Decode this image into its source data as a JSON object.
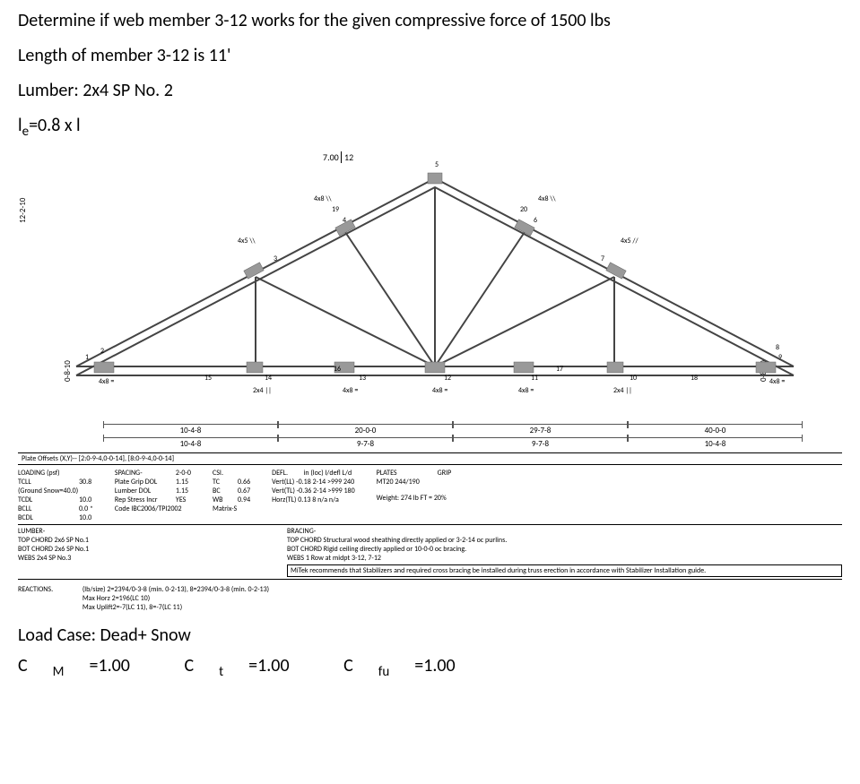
{
  "problem": {
    "line1": "Determine if web member 3-12 works for the given compressive force of 1500 lbs",
    "line2": "Length of member 3-12 is 11'",
    "line3": "Lumber: 2x4 SP No. 2",
    "line4_prefix": "l",
    "line4_sub": "e",
    "line4_suffix": "=0.8 x l"
  },
  "pitch": {
    "rise": "7.00",
    "run": "12"
  },
  "vlabels": {
    "left_outer": "12-2-10",
    "left_inner": "0-8-10",
    "right_inner": "0-8-10"
  },
  "truss": {
    "plates": {
      "p1": "4x8 =",
      "p2": "4x5 \\\\",
      "p3": "4x8 \\\\",
      "p4": "4x8 \\\\",
      "p5": "4x5 //",
      "p6": "4x8 =",
      "b14": "2x4 ||",
      "b13": "4x8 =",
      "b12": "4x8 =",
      "b11": "4x8 =",
      "b10": "2x4 ||"
    },
    "nodes": {
      "n1": "1",
      "n2": "2",
      "n3": "3",
      "n4": "4",
      "n5": "5",
      "n6": "6",
      "n7": "7",
      "n8": "8",
      "n9": "9",
      "n10": "10",
      "n11": "11",
      "n12": "12",
      "n13": "13",
      "n14": "14",
      "n15": "15",
      "n16": "16",
      "n17": "17",
      "n18": "18",
      "n19": "19",
      "n20": "20"
    }
  },
  "dims": {
    "top": [
      "10-4-8",
      "20-0-0",
      "29-7-8",
      "40-0-0"
    ],
    "bot": [
      "10-4-8",
      "9-7-8",
      "9-7-8",
      "10-4-8"
    ]
  },
  "offsets": "Plate Offsets (X,Y)-- [2:0-9-4,0-0-14], [8:0-9-4,0-0-14]",
  "loading": {
    "hdr": "LOADING (psf)",
    "rows": [
      {
        "k": "TCLL",
        "v": "30.8"
      },
      {
        "k": "(Ground Snow=40.0)",
        "v": ""
      },
      {
        "k": "TCDL",
        "v": "10.0"
      },
      {
        "k": "BCLL",
        "v": "0.0 *"
      },
      {
        "k": "BCDL",
        "v": "10.0"
      }
    ]
  },
  "spacing": {
    "hdr": "SPACING-",
    "hv": "2-0-0",
    "rows": [
      {
        "k": "Plate Grip DOL",
        "v": "1.15"
      },
      {
        "k": "Lumber DOL",
        "v": "1.15"
      },
      {
        "k": "Rep Stress Incr",
        "v": "YES"
      },
      {
        "k": "Code IBC2006/TPI2002",
        "v": ""
      }
    ]
  },
  "csi": {
    "hdr": "CSI.",
    "rows": [
      {
        "k": "TC",
        "v": "0.66"
      },
      {
        "k": "BC",
        "v": "0.67"
      },
      {
        "k": "WB",
        "v": "0.94"
      },
      {
        "k": "Matrix-S",
        "v": ""
      }
    ]
  },
  "defl": {
    "hdr": "DEFL.",
    "cols": "in   (loc)   l/defl   L/d",
    "rows": [
      "Vert(LL)   -0.18   2-14   >999   240",
      "Vert(TL)   -0.36   2-14   >999   180",
      "Horz(TL)    0.13    8      n/a    n/a"
    ]
  },
  "plates": {
    "hdr": "PLATES",
    "grip": "GRIP",
    "row": "MT20            244/190",
    "weight": "Weight: 274 lb     FT = 20%"
  },
  "lumber": {
    "hdr": "LUMBER-",
    "rows": [
      "TOP CHORD  2x6 SP No.1",
      "BOT CHORD  2x6 SP No.1",
      "WEBS           2x4 SP No.3"
    ]
  },
  "bracing": {
    "hdr": "BRACING-",
    "rows": [
      "TOP CHORD   Structural wood sheathing directly applied or 3-2-14 oc purlins.",
      "BOT CHORD   Rigid ceiling directly applied or 10-0-0 oc bracing.",
      "WEBS            1 Row at midpt       3-12, 7-12"
    ],
    "note": "MiTek recommends that Stabilizers and required cross bracing be installed during truss erection in accordance with Stabilizer Installation guide."
  },
  "reactions": {
    "hdr": "REACTIONS.",
    "lines": [
      "(lb/size)   2=2394/0-3-8 (min. 0-2-13), 8=2394/0-3-8 (min. 0-2-13)",
      "Max Horz 2=196(LC 10)",
      "Max Uplift2=-7(LC 11), 8=-7(LC 11)"
    ]
  },
  "loadcase": "Load Case: Dead+ Snow",
  "coefs": {
    "c1p": "C",
    "c1s": "M",
    "c1v": "=1.00",
    "c2p": "C",
    "c2s": "t",
    "c2v": "=1.00",
    "c3p": "C",
    "c3s": "fu",
    "c3v": "=1.00"
  }
}
